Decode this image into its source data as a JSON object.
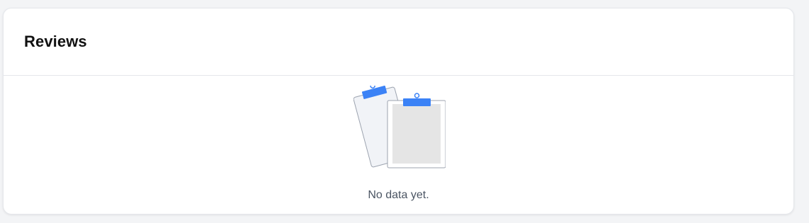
{
  "reviews_card": {
    "title": "Reviews",
    "empty_state": {
      "message": "No data yet.",
      "icon": "empty-clipboards-icon",
      "accent_color": "#3b82f6"
    }
  }
}
